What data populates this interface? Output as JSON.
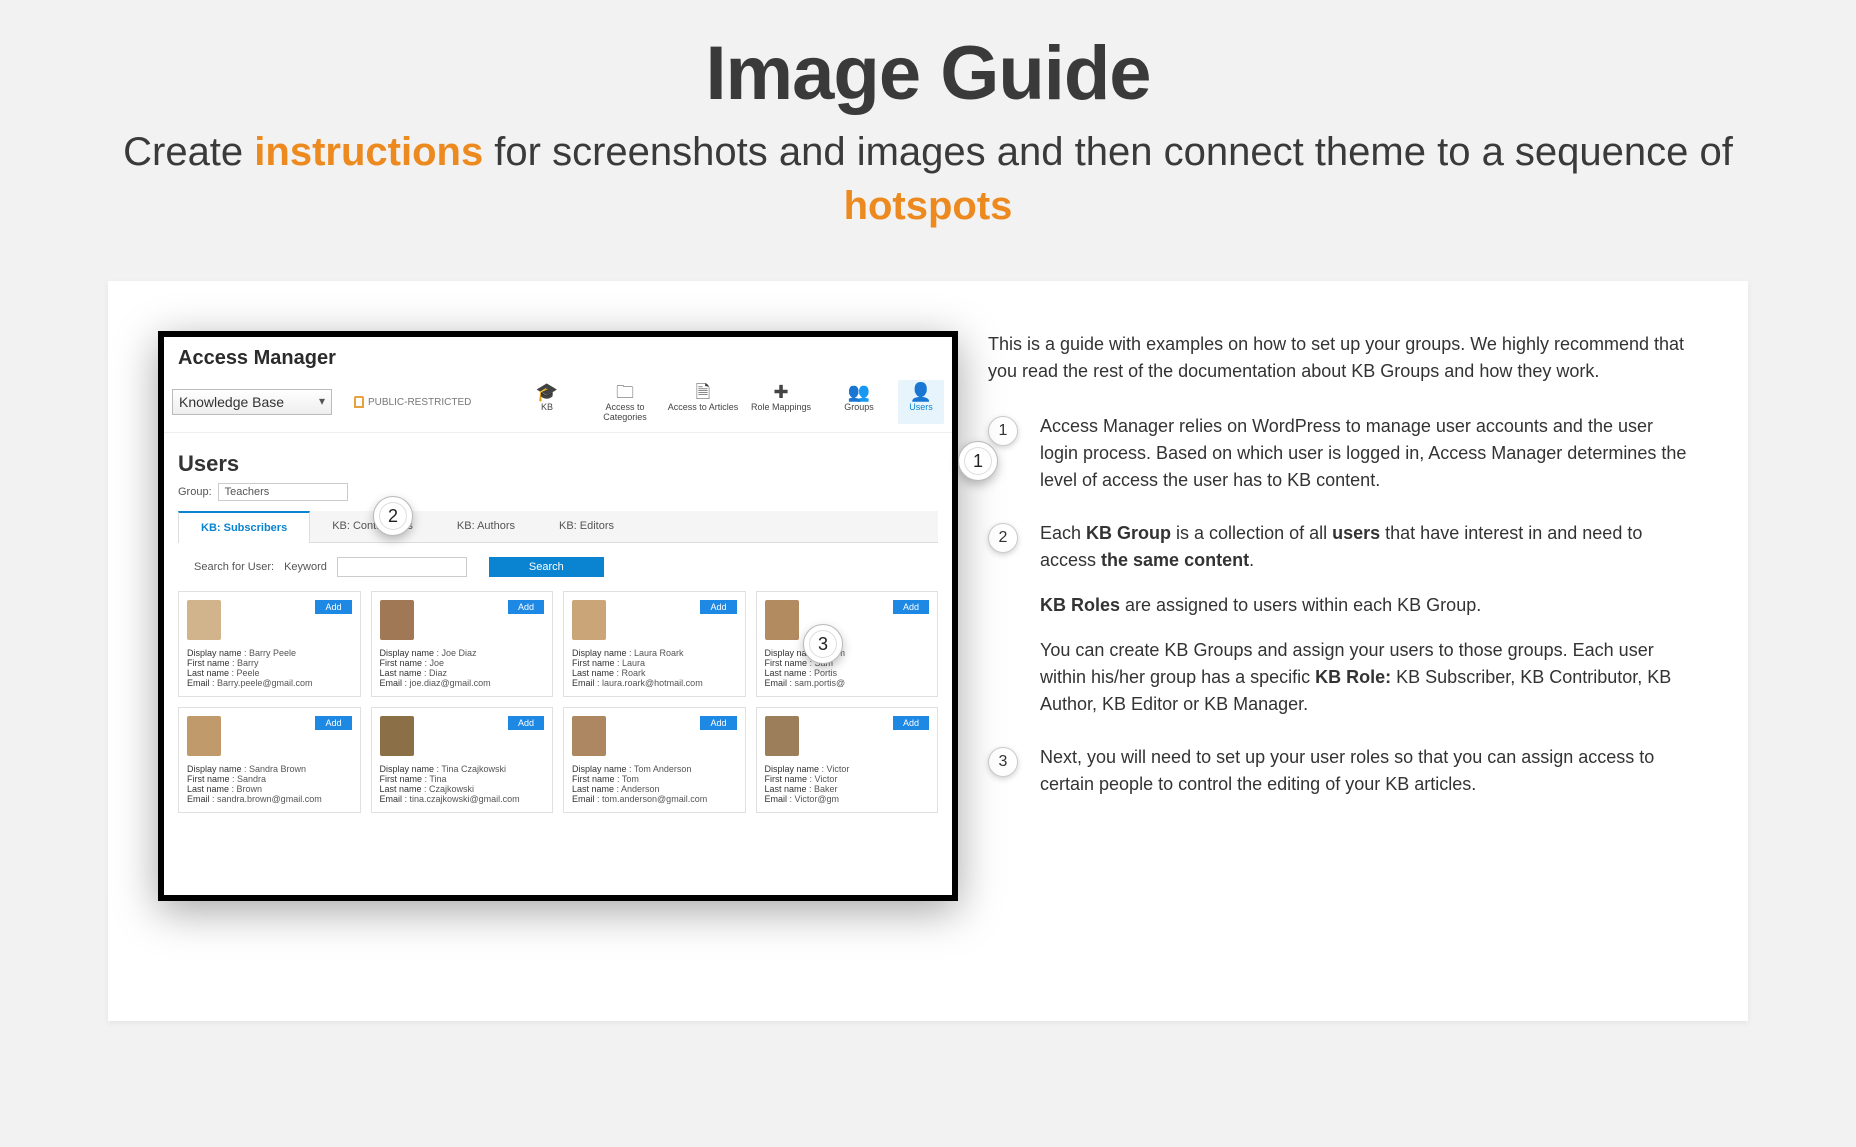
{
  "title": "Image Guide",
  "subtitle_pre": "Create ",
  "subtitle_b1": "instructions",
  "subtitle_mid": " for screenshots and images and then connect theme to a sequence of ",
  "subtitle_b2": "hotspots",
  "shot": {
    "header": "Access Manager",
    "kb_select": "Knowledge Base",
    "restrict_badge": "PUBLIC-RESTRICTED",
    "nav": [
      "KB",
      "Access to Categories",
      "Access to Articles",
      "Role Mappings",
      "Groups",
      "Users"
    ],
    "section": "Users",
    "group_label": "Group:",
    "group_value": "Teachers",
    "role_tabs": [
      "KB: Subscribers",
      "KB: Contributors",
      "KB: Authors",
      "KB: Editors"
    ],
    "search_label": "Search for User:",
    "keyword_label": "Keyword",
    "search_btn": "Search",
    "add_btn": "Add",
    "field_labels": {
      "display": "Display name",
      "first": "First name",
      "last": "Last name",
      "email": "Email"
    },
    "users": [
      {
        "display": "Barry Peele",
        "first": "Barry",
        "last": "Peele",
        "email": "Barry.peele@gmail.com"
      },
      {
        "display": "Joe Diaz",
        "first": "Joe",
        "last": "Diaz",
        "email": "joe.diaz@gmail.com"
      },
      {
        "display": "Laura Roark",
        "first": "Laura",
        "last": "Roark",
        "email": "laura.roark@hotmail.com"
      },
      {
        "display": "Sam",
        "first": "Sam",
        "last": "Portis",
        "email": "sam.portis@"
      },
      {
        "display": "Sandra Brown",
        "first": "Sandra",
        "last": "Brown",
        "email": "sandra.brown@gmail.com"
      },
      {
        "display": "Tina Czajkowski",
        "first": "Tina",
        "last": "Czajkowski",
        "email": "tina.czajkowski@gmail.com"
      },
      {
        "display": "Tom Anderson",
        "first": "Tom",
        "last": "Anderson",
        "email": "tom.anderson@gmail.com"
      },
      {
        "display": "Victor",
        "first": "Victor",
        "last": "Baker",
        "email": "Victor@gm"
      }
    ],
    "hotspots": {
      "1": "1",
      "2": "2",
      "3": "3"
    }
  },
  "guide": {
    "intro": "This is a guide with examples on how to set up your groups. We highly recommend that you read the rest of the documentation about KB Groups and how they work.",
    "steps": {
      "1": "Access Manager relies on WordPress to manage user accounts and the user login process. Based on which user is logged in, Access Manager determines the level of access the user has to KB content.",
      "2a_pre": "Each ",
      "2a_kbgroup": "KB Group",
      "2a_mid": " is a collection of all ",
      "2a_users": "users",
      "2a_mid2": " that have interest in and need to access ",
      "2a_same": "the same content",
      "2a_end": ".",
      "2b_roles": "KB Roles",
      "2b_rest": " are assigned to users within each KB Group.",
      "2c_pre": "You can create KB Groups and assign your users to those groups. Each user within his/her group has a specific ",
      "2c_role": "KB Role:",
      "2c_rest": " KB Subscriber, KB Contributor, KB Author, KB Editor or KB Manager.",
      "3": "Next, you will need to set up your user roles so that you can assign access to certain people to control the editing of your KB articles."
    }
  }
}
